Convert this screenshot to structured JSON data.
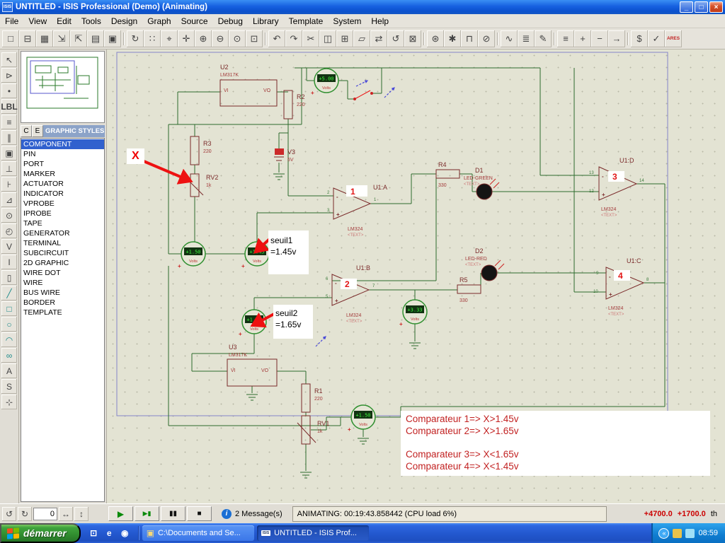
{
  "window": {
    "title": "UNTITLED - ISIS Professional (Demo) (Animating)",
    "app_badge": "ISIS",
    "minimize": "_",
    "maximize": "□",
    "close": "×"
  },
  "menubar": {
    "items": [
      "File",
      "View",
      "Edit",
      "Tools",
      "Design",
      "Graph",
      "Source",
      "Debug",
      "Library",
      "Template",
      "System",
      "Help"
    ]
  },
  "toolbar": {
    "icons": [
      {
        "name": "new-design-button",
        "glyph": "□"
      },
      {
        "name": "open-design-button",
        "glyph": "⊟"
      },
      {
        "name": "save-design-button",
        "glyph": "▦"
      },
      {
        "name": "import-section-button",
        "glyph": "⇲"
      },
      {
        "name": "export-section-button",
        "glyph": "⇱"
      },
      {
        "name": "print-button",
        "glyph": "▤"
      },
      {
        "name": "mark-output-area-button",
        "glyph": "▣"
      },
      {
        "name": "toolbar-separator",
        "cls": "tsep",
        "glyph": ""
      },
      {
        "name": "redraw-button",
        "glyph": "↻"
      },
      {
        "name": "toggle-grid-button",
        "glyph": "∷"
      },
      {
        "name": "false-origin-button",
        "glyph": "⌖"
      },
      {
        "name": "center-at-cursor-button",
        "glyph": "✛"
      },
      {
        "name": "zoom-in-button",
        "glyph": "⊕"
      },
      {
        "name": "zoom-out-button",
        "glyph": "⊖"
      },
      {
        "name": "zoom-all-button",
        "glyph": "⊙"
      },
      {
        "name": "zoom-area-button",
        "glyph": "⊡"
      },
      {
        "name": "toolbar-separator",
        "cls": "tsep",
        "glyph": ""
      },
      {
        "name": "undo-button",
        "glyph": "↶"
      },
      {
        "name": "redo-button",
        "glyph": "↷"
      },
      {
        "name": "cut-button",
        "glyph": "✂"
      },
      {
        "name": "copy-button",
        "glyph": "◫"
      },
      {
        "name": "paste-button",
        "glyph": "⊞"
      },
      {
        "name": "block-copy-button",
        "glyph": "▱"
      },
      {
        "name": "block-move-button",
        "glyph": "⇄"
      },
      {
        "name": "block-rotate-button",
        "glyph": "↺"
      },
      {
        "name": "block-delete-button",
        "glyph": "⊠"
      },
      {
        "name": "toolbar-separator",
        "cls": "tsep",
        "glyph": ""
      },
      {
        "name": "pick-device-button",
        "glyph": "⊛"
      },
      {
        "name": "make-device-button",
        "glyph": "✱"
      },
      {
        "name": "packaging-tool-button",
        "glyph": "⊓"
      },
      {
        "name": "decompose-button",
        "glyph": "⊘"
      },
      {
        "name": "toolbar-separator",
        "cls": "tsep",
        "glyph": ""
      },
      {
        "name": "wire-autorouter-button",
        "glyph": "∿"
      },
      {
        "name": "search-and-tag-button",
        "glyph": "≣"
      },
      {
        "name": "property-assignment-button",
        "glyph": "✎"
      },
      {
        "name": "toolbar-separator",
        "cls": "tsep",
        "glyph": ""
      },
      {
        "name": "design-explorer-button",
        "glyph": "≡"
      },
      {
        "name": "new-sheet-button",
        "glyph": "+"
      },
      {
        "name": "remove-sheet-button",
        "glyph": "−"
      },
      {
        "name": "goto-sheet-button",
        "glyph": "→"
      },
      {
        "name": "toolbar-separator",
        "cls": "tsep",
        "glyph": ""
      },
      {
        "name": "bill-of-materials-button",
        "glyph": "$"
      },
      {
        "name": "electrical-rules-check-button",
        "glyph": "✓"
      },
      {
        "name": "netlist-to-ares-button",
        "glyph": "ARES",
        "cls": "red"
      }
    ]
  },
  "left_toolbar": {
    "icons": [
      {
        "name": "selection-pointer-button",
        "glyph": "↖"
      },
      {
        "name": "component-mode-button",
        "glyph": "⊳"
      },
      {
        "name": "junction-dot-button",
        "glyph": "•"
      },
      {
        "name": "wire-label-button",
        "glyph": "LBL",
        "cls": "tiny"
      },
      {
        "name": "text-script-button",
        "glyph": "≡"
      },
      {
        "name": "bus-mode-button",
        "glyph": "∥"
      },
      {
        "name": "subcircuit-button",
        "glyph": "▣"
      },
      {
        "name": "terminal-mode-button",
        "glyph": "⊥"
      },
      {
        "name": "device-pin-button",
        "glyph": "⊦"
      },
      {
        "name": "graph-mode-button",
        "glyph": "⊿"
      },
      {
        "name": "tape-recorder-button",
        "glyph": "⊙"
      },
      {
        "name": "generator-mode-button",
        "glyph": "◴"
      },
      {
        "name": "voltage-probe-button",
        "glyph": "V"
      },
      {
        "name": "current-probe-button",
        "glyph": "I"
      },
      {
        "name": "virtual-instruments-button",
        "glyph": "▯"
      },
      {
        "name": "2d-line-button",
        "glyph": "╱",
        "cls": "teal"
      },
      {
        "name": "2d-box-button",
        "glyph": "□",
        "cls": "teal"
      },
      {
        "name": "2d-circle-button",
        "glyph": "○",
        "cls": "teal"
      },
      {
        "name": "2d-arc-button",
        "glyph": "◠",
        "cls": "teal"
      },
      {
        "name": "2d-path-button",
        "glyph": "∞",
        "cls": "teal"
      },
      {
        "name": "2d-text-button",
        "glyph": "A"
      },
      {
        "name": "2d-symbol-button",
        "glyph": "S"
      },
      {
        "name": "marker-mode-button",
        "glyph": "⊹"
      }
    ]
  },
  "sidebar": {
    "c_button": "C",
    "e_button": "E",
    "header": "GRAPHIC STYLES",
    "items": [
      {
        "label": "COMPONENT",
        "cls": "selected",
        "name": "selector-item-component"
      },
      {
        "label": "PIN",
        "name": "selector-item-pin"
      },
      {
        "label": "PORT",
        "name": "selector-item-port"
      },
      {
        "label": "MARKER",
        "name": "selector-item-marker"
      },
      {
        "label": "ACTUATOR",
        "name": "selector-item-actuator"
      },
      {
        "label": "INDICATOR",
        "name": "selector-item-indicator"
      },
      {
        "label": "VPROBE",
        "name": "selector-item-vprobe"
      },
      {
        "label": "IPROBE",
        "name": "selector-item-iprobe"
      },
      {
        "label": "TAPE",
        "name": "selector-item-tape"
      },
      {
        "label": "GENERATOR",
        "name": "selector-item-generator"
      },
      {
        "label": "TERMINAL",
        "name": "selector-item-terminal"
      },
      {
        "label": "SUBCIRCUIT",
        "name": "selector-item-subcircuit"
      },
      {
        "label": "2D GRAPHIC",
        "name": "selector-item-2d-graphic"
      },
      {
        "label": "WIRE DOT",
        "name": "selector-item-wire-dot"
      },
      {
        "label": "WIRE",
        "name": "selector-item-wire"
      },
      {
        "label": "BUS WIRE",
        "name": "selector-item-bus-wire"
      },
      {
        "label": "BORDER",
        "name": "selector-item-border"
      },
      {
        "label": "TEMPLATE",
        "name": "selector-item-template"
      }
    ]
  },
  "schematic": {
    "sym": {
      "plus": "+",
      "minus": "-"
    },
    "meters": {
      "label": "Volts",
      "top": "+5.00",
      "m1": "+1.50",
      "m2": "+1.45",
      "m3": "+1.65",
      "m4": "+3.33",
      "m5": "+1.50"
    },
    "components": {
      "u2": {
        "ref": "U2",
        "value": "LM317K",
        "pin1": "VI",
        "pin2": "VO"
      },
      "u3": {
        "ref": "U3",
        "value": "LM317K",
        "pin1": "VI",
        "pin2": "VO"
      },
      "r1": {
        "ref": "R1",
        "value": "220"
      },
      "r2": {
        "ref": "R2",
        "value": "220"
      },
      "r3": {
        "ref": "R3",
        "value": "220"
      },
      "r4": {
        "ref": "R4",
        "value": "330"
      },
      "r5": {
        "ref": "R5",
        "value": "330"
      },
      "rv1": {
        "ref": "RV1",
        "value": "1k"
      },
      "rv2": {
        "ref": "RV2",
        "value": "1k"
      },
      "v3": {
        "ref": "V3",
        "value": "5V"
      },
      "d1": {
        "ref": "D1",
        "value": "LED-GREEN",
        "prop": "<TEXT>"
      },
      "d2": {
        "ref": "D2",
        "value": "LED-RED",
        "prop": "<TEXT>"
      },
      "u1a": {
        "ref": "U1:A",
        "num": "1",
        "type": "LM324",
        "prop": "<TEXT>",
        "pin_minus": "2",
        "pin_plus": "3",
        "pin_out": "1"
      },
      "u1b": {
        "ref": "U1:B",
        "num": "2",
        "type": "LM324",
        "prop": "<TEXT>",
        "pin_minus": "6",
        "pin_plus": "5",
        "pin_out": "7"
      },
      "u1d": {
        "ref": "U1:D",
        "num": "3",
        "type": "LM324",
        "prop": "<TEXT>",
        "pin_minus": "13",
        "pin_plus": "12",
        "pin_out": "14"
      },
      "u1c": {
        "ref": "U1:C",
        "num": "4",
        "type": "LM324",
        "prop": "<TEXT>",
        "pin_minus": "9",
        "pin_plus": "10",
        "pin_out": "8"
      }
    },
    "annotations": {
      "x": "X",
      "seuil1_l1": "seuil1",
      "seuil1_l2": "=1.45v",
      "seuil2_l1": "seuil2",
      "seuil2_l2": "=1.65v",
      "notes": [
        "Comparateur 1=> X>1.45v",
        "Comparateur 2=> X>1.65v",
        "Comparateur 3=> X<1.65v",
        "Comparateur 4=> X<1.45v"
      ]
    }
  },
  "controls": {
    "rotate_ccw": "↺",
    "rotate_cw": "↻",
    "angle": "0",
    "mirror_h": "↔",
    "mirror_v": "↕",
    "play": "▶",
    "step": "▶▮",
    "pause": "▮▮",
    "stop": "■",
    "info": "i",
    "messages": "2 Message(s)",
    "status": "ANIMATING: 00:19:43.858442 (CPU load 6%)",
    "coord_x": "+4700.0",
    "coord_y": "+1700.0",
    "coord_units": "th"
  },
  "taskbar": {
    "start": "démarrer",
    "quicklaunch": [
      {
        "name": "show-desktop-icon",
        "glyph": "⊡"
      },
      {
        "name": "internet-explorer-icon",
        "glyph": "e"
      },
      {
        "name": "media-player-icon",
        "glyph": "◉"
      }
    ],
    "tasks": [
      {
        "label": "C:\\Documents and Se..."
      },
      {
        "label": "UNTITLED - ISIS Prof..."
      }
    ],
    "task_icon_isis": "ISIS",
    "tray_chevron": "«",
    "time": "08:59"
  }
}
